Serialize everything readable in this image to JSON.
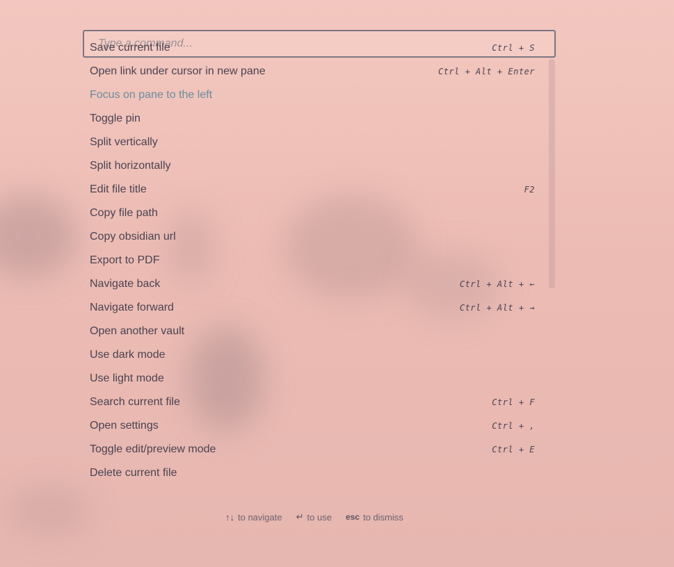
{
  "search": {
    "placeholder": "Type a command...",
    "value": ""
  },
  "commands": [
    {
      "label": "Save current file",
      "shortcut": "Ctrl + S",
      "active": false
    },
    {
      "label": "Open link under cursor in new pane",
      "shortcut": "Ctrl + Alt + Enter",
      "active": false
    },
    {
      "label": "Focus on pane to the left",
      "shortcut": "",
      "active": true
    },
    {
      "label": "Toggle pin",
      "shortcut": "",
      "active": false
    },
    {
      "label": "Split vertically",
      "shortcut": "",
      "active": false
    },
    {
      "label": "Split horizontally",
      "shortcut": "",
      "active": false
    },
    {
      "label": "Edit file title",
      "shortcut": "F2",
      "active": false
    },
    {
      "label": "Copy file path",
      "shortcut": "",
      "active": false
    },
    {
      "label": "Copy obsidian url",
      "shortcut": "",
      "active": false
    },
    {
      "label": "Export to PDF",
      "shortcut": "",
      "active": false
    },
    {
      "label": "Navigate back",
      "shortcut": "Ctrl + Alt + ←",
      "active": false
    },
    {
      "label": "Navigate forward",
      "shortcut": "Ctrl + Alt + →",
      "active": false
    },
    {
      "label": "Open another vault",
      "shortcut": "",
      "active": false
    },
    {
      "label": "Use dark mode",
      "shortcut": "",
      "active": false
    },
    {
      "label": "Use light mode",
      "shortcut": "",
      "active": false
    },
    {
      "label": "Search current file",
      "shortcut": "Ctrl + F",
      "active": false
    },
    {
      "label": "Open settings",
      "shortcut": "Ctrl + ,",
      "active": false
    },
    {
      "label": "Toggle edit/preview mode",
      "shortcut": "Ctrl + E",
      "active": false
    },
    {
      "label": "Delete current file",
      "shortcut": "",
      "active": false
    }
  ],
  "footer": {
    "navigate_key": "↑↓",
    "navigate_label": "to navigate",
    "use_key": "↵",
    "use_label": "to use",
    "dismiss_key": "esc",
    "dismiss_label": "to dismiss"
  },
  "colors": {
    "active_item": "#6a8d9d",
    "text": "#4a4352"
  }
}
